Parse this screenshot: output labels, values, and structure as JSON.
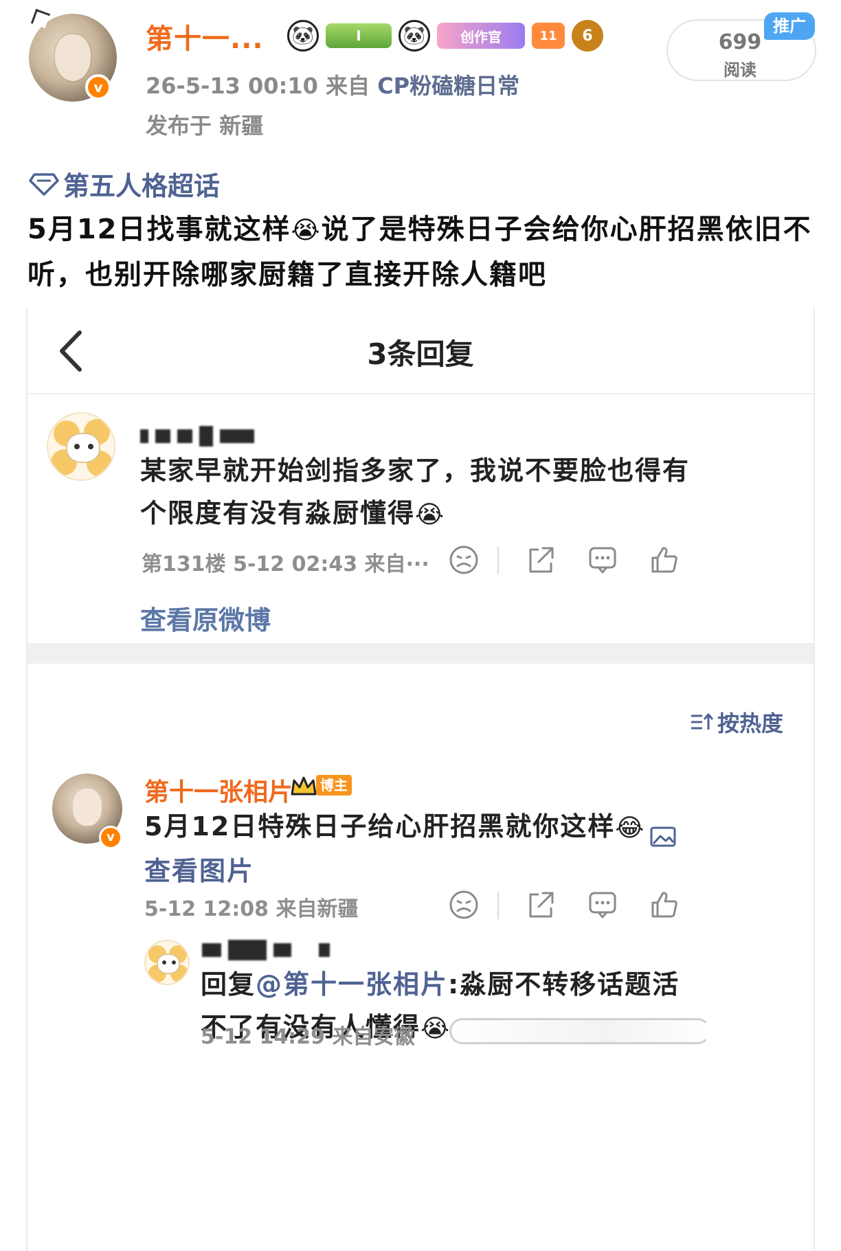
{
  "post": {
    "author_name": "第十一...",
    "verified_mark": "v",
    "creator_badge": "创作官",
    "bamboo_badge": "I",
    "level_badge": "11",
    "coin_badge": "6",
    "time": "26-5-13 00:10",
    "from_label": "来自",
    "source": "CP粉磕糖日常",
    "location_line": "发布于 新疆",
    "reads_count": "699",
    "reads_label": "阅读",
    "promo_tag": "推广",
    "topic": "第五人格超话",
    "text_part1": "5月12日找事就这样",
    "text_emoji": "😭",
    "text_part2": "说了是特殊日子会给你心肝招黑依旧不听，也别开除哪家厨籍了直接开除人籍吧"
  },
  "screenshot": {
    "nav_title": "3条回复",
    "comment1": {
      "text": "某家早就开始剑指多家了，我说不要脸也得有个限度有没有淼厨懂得",
      "emoji": "😭",
      "meta": "第131楼 5-12 02:43 来自···",
      "view_original": "查看原微博"
    },
    "sort_label": "按热度",
    "comment2": {
      "author": "第十一张相片",
      "blogger_tag": "博主",
      "text": "5月12日特殊日子给心肝招黑就你这样",
      "emoji": "😂",
      "view_image": "查看图片",
      "meta": "5-12 12:08 来自新疆"
    },
    "reply": {
      "prefix": "回复",
      "mention": "@第十一张相片",
      "text": ":淼厨不转移话题活不了有没有人懂得",
      "emoji": "😭",
      "meta": "5-12 14:29 来自安徽"
    }
  },
  "colors": {
    "brand_orange": "#f06a1d",
    "link_blue": "#4f6292",
    "promo_blue": "#4ea6f3"
  }
}
